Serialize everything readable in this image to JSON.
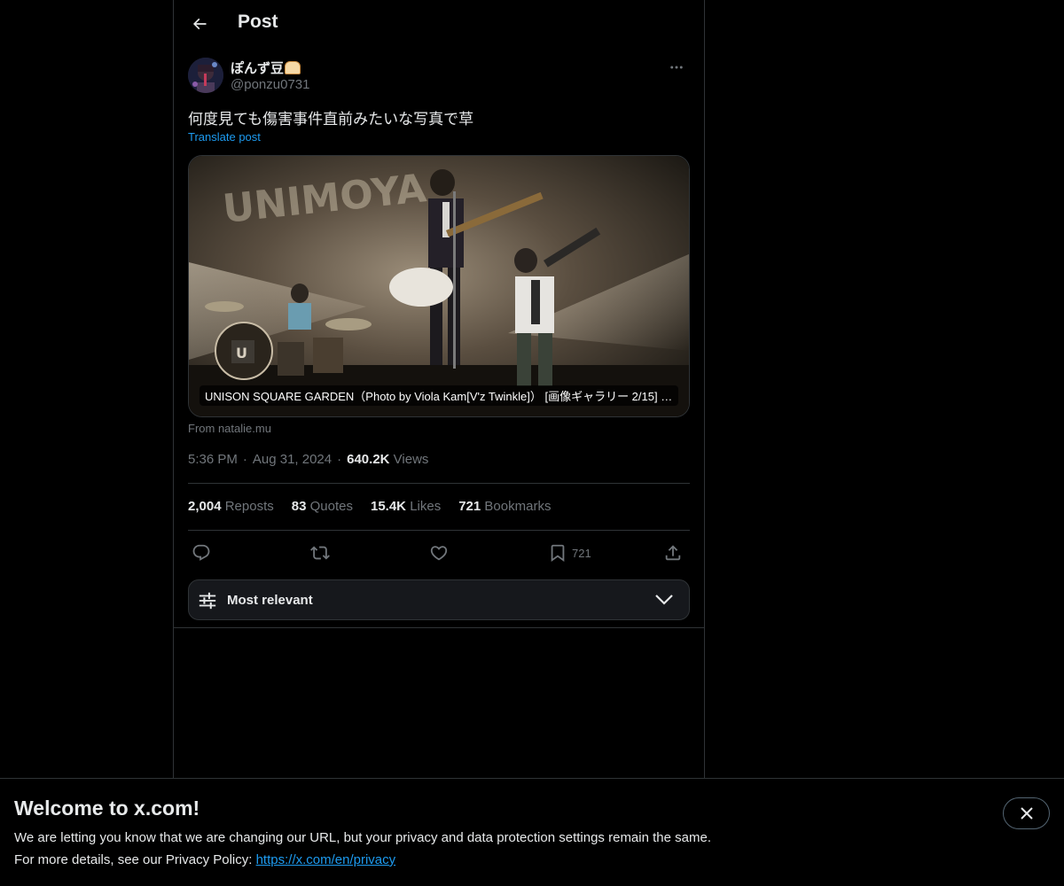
{
  "header": {
    "title": "Post",
    "back_icon": "arrow-left-icon"
  },
  "post": {
    "author": {
      "display_name": "ぽんず豆",
      "handle": "@ponzu0731"
    },
    "text": "何度見ても傷害事件直前みたいな写真で草",
    "translate_label": "Translate post",
    "card": {
      "caption": "UNISON SQUARE GARDEN（Photo by Viola Kam[V'z Twinkle]） [画像ギャラリー 2/15] - ...",
      "source": "From natalie.mu"
    },
    "meta": {
      "time": "5:36 PM",
      "date": "Aug 31, 2024",
      "views_count": "640.2K",
      "views_label": "Views"
    },
    "stats": {
      "reposts_count": "2,004",
      "reposts_label": "Reposts",
      "quotes_count": "83",
      "quotes_label": "Quotes",
      "likes_count": "15.4K",
      "likes_label": "Likes",
      "bookmarks_count": "721",
      "bookmarks_label": "Bookmarks"
    },
    "actions": {
      "bookmark_count": "721"
    }
  },
  "replies_sort": {
    "label": "Most relevant"
  },
  "banner": {
    "title": "Welcome to x.com!",
    "line1": "We are letting you know that we are changing our URL, but your privacy and data protection settings remain the same.",
    "line2_prefix": "For more details, see our Privacy Policy: ",
    "privacy_link": "https://x.com/en/privacy"
  },
  "colors": {
    "background": "#000000",
    "accent": "#1d9bf0",
    "text_primary": "#e7e9ea",
    "text_secondary": "#71767b",
    "border": "#2f3336"
  }
}
